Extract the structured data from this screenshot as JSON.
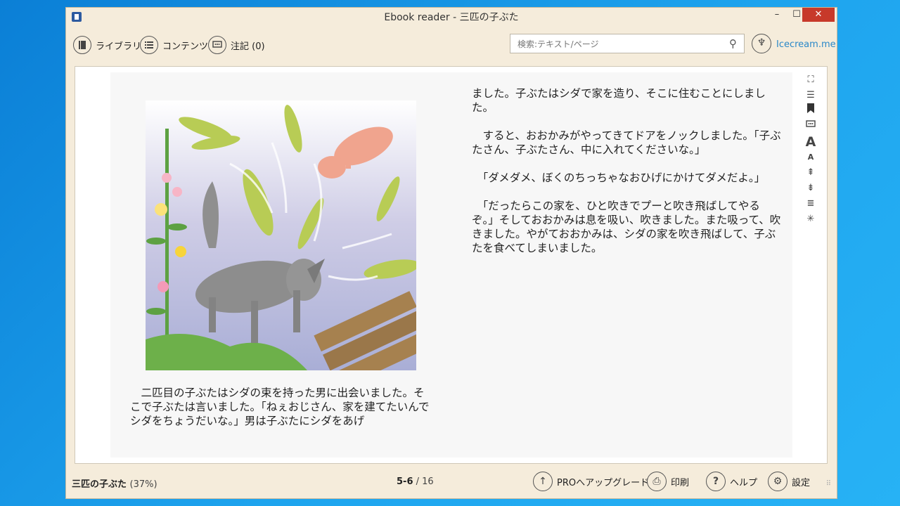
{
  "window": {
    "title": "Ebook reader - 三匹の子ぶた",
    "minimize": "–",
    "maximize": "☐",
    "close": "✕"
  },
  "toolbar": {
    "library": "ライブラリ",
    "contents": "コンテンツ",
    "notes": "注記 (0)",
    "search_placeholder": "検索:テキスト/ページ",
    "brand_link": "Icecream.me"
  },
  "icons": {
    "library": "book-icon",
    "contents": "list-icon",
    "notes": "comment-icon",
    "search": "search-icon",
    "brand": "icecream-logo-icon"
  },
  "page": {
    "left_caption": "　二匹目の子ぶたはシダの束を持った男に出会いました。そこで子ぶたは言いました。「ねぇおじさん、家を建てたいんでシダをちょうだいな。」男は子ぶたにシダをあげ",
    "right_paragraphs": [
      "ました。子ぶたはシダで家を造り、そこに住むことにしました。",
      "　すると、おおかみがやってきてドアをノックしました。「子ぶたさん、子ぶたさん、中に入れてくださいな。」",
      "　「ダメダメ、ぼくのちっちゃなおひげにかけてダメだよ。」",
      "　「だったらこの家を、ひと吹きでプーと吹き飛ばしてやるぞ。」そしておおかみは息を吸い、吹きました。また吸って、吹きました。やがておおかみは、シダの家を吹き飛ばして、子ぶたを食べてしまいました。"
    ]
  },
  "side_tools": [
    "fullscreen-icon",
    "toc-icon",
    "bookmark-icon",
    "notes-icon",
    "font-increase-icon",
    "font-decrease-icon",
    "line-spacing-increase-icon",
    "line-spacing-decrease-icon",
    "justify-icon",
    "brightness-icon"
  ],
  "status": {
    "book_title": "三匹の子ぶた",
    "progress": "(37%)",
    "page_current": "5-6",
    "page_sep": " / ",
    "page_total": "16",
    "upgrade": "PROへアップグレード",
    "print": "印刷",
    "help": "ヘルプ",
    "settings": "設定"
  },
  "colors": {
    "window_bg": "#f5ecdb",
    "accent_link": "#2a88c8",
    "close_button": "#c7392a",
    "desktop": "#1ea4ee"
  }
}
